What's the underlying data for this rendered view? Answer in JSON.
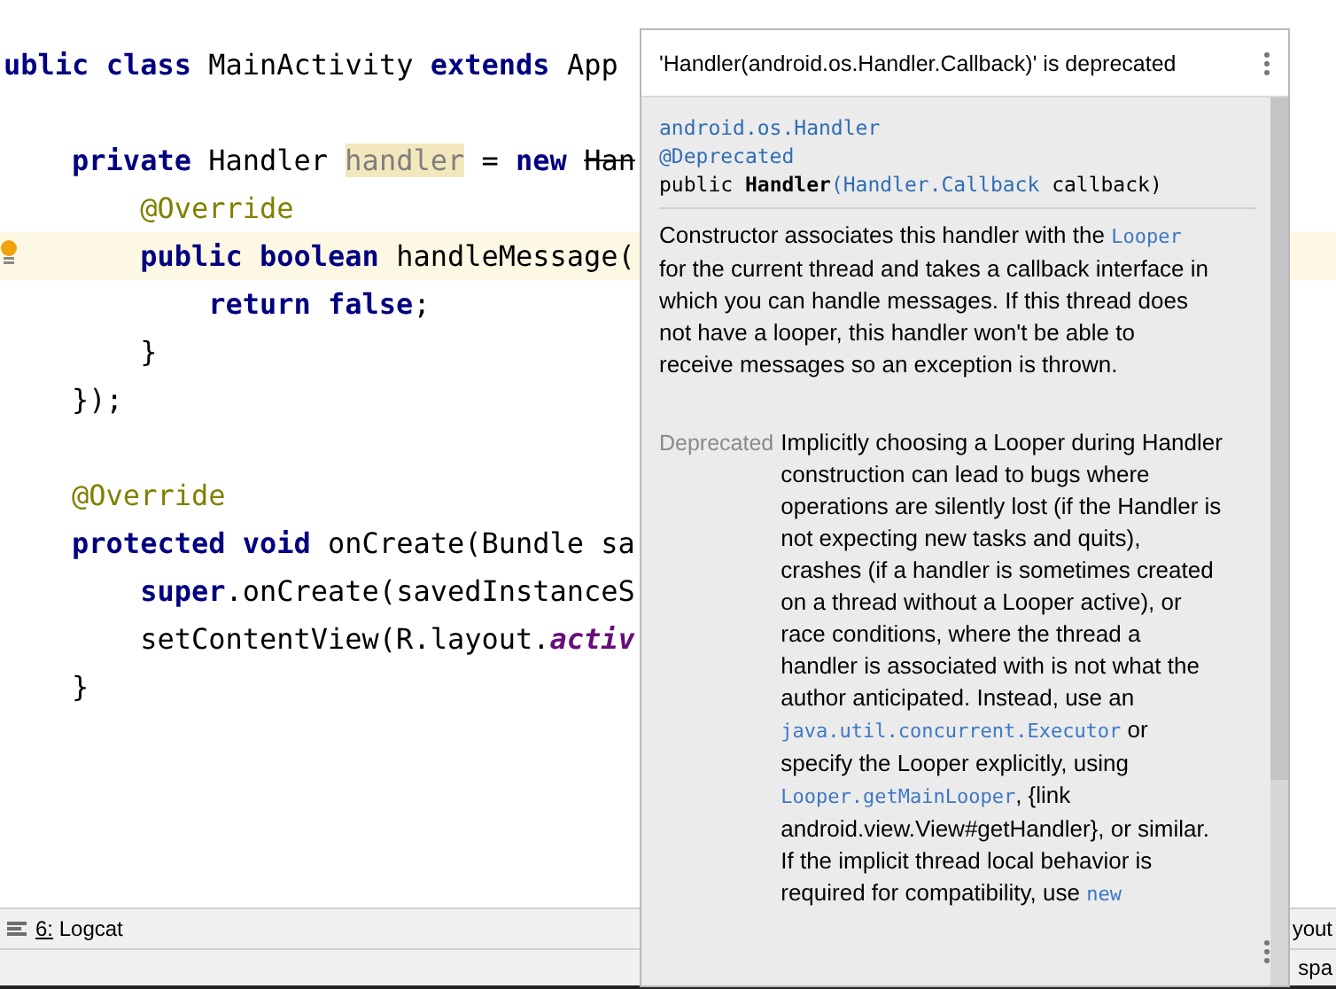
{
  "editor": {
    "lines": [
      {
        "kind": "code",
        "tokens": [
          {
            "kind": "keyword",
            "text": "ublic"
          },
          {
            "kind": "keyword",
            "text": " class"
          },
          {
            "kind": "plain",
            "text": " MainActivity "
          },
          {
            "kind": "keyword",
            "text": "extends"
          },
          {
            "kind": "plain",
            "text": " App"
          }
        ]
      },
      {
        "kind": "blank"
      },
      {
        "kind": "code",
        "tokens": [
          {
            "kind": "keyword",
            "text": "    private"
          },
          {
            "kind": "plain",
            "text": " Handler "
          },
          {
            "kind": "unused",
            "text": "handler"
          },
          {
            "kind": "plain",
            "text": " = "
          },
          {
            "kind": "keyword",
            "text": "new"
          },
          {
            "kind": "deprecated",
            "text": " Han"
          }
        ]
      },
      {
        "kind": "code",
        "tokens": [
          {
            "kind": "annotation",
            "text": "        @Override"
          }
        ]
      },
      {
        "kind": "code",
        "current": true,
        "bulb": true,
        "tokens": [
          {
            "kind": "keyword",
            "text": "        public boolean"
          },
          {
            "kind": "plain",
            "text": " handleMessage("
          }
        ]
      },
      {
        "kind": "code",
        "tokens": [
          {
            "kind": "keyword",
            "text": "            return false"
          },
          {
            "kind": "plain",
            "text": ";"
          }
        ]
      },
      {
        "kind": "code",
        "tokens": [
          {
            "kind": "plain",
            "text": "        }"
          }
        ]
      },
      {
        "kind": "code",
        "tokens": [
          {
            "kind": "plain",
            "text": "    });"
          }
        ]
      },
      {
        "kind": "blank"
      },
      {
        "kind": "code",
        "tokens": [
          {
            "kind": "annotation",
            "text": "    @Override"
          }
        ]
      },
      {
        "kind": "code",
        "tokens": [
          {
            "kind": "keyword",
            "text": "    protected void"
          },
          {
            "kind": "plain",
            "text": " onCreate(Bundle sa"
          }
        ]
      },
      {
        "kind": "code",
        "tokens": [
          {
            "kind": "keyword",
            "text": "        super"
          },
          {
            "kind": "plain",
            "text": ".onCreate(savedInstanceS"
          }
        ]
      },
      {
        "kind": "code",
        "tokens": [
          {
            "kind": "plain",
            "text": "        setContentView(R.layout."
          },
          {
            "kind": "static",
            "text": "activ"
          }
        ]
      },
      {
        "kind": "code",
        "tokens": [
          {
            "kind": "plain",
            "text": "    }"
          }
        ]
      }
    ]
  },
  "tool_window_bar": {
    "tab": "6: Logcat",
    "right_text": "yout"
  },
  "status_bar": {
    "right_text": "spa"
  },
  "popup": {
    "title": "'Handler(android.os.Handler.Callback)' is deprecated",
    "signature": [
      [
        {
          "kind": "link",
          "text": "android.os.Handler"
        }
      ],
      [
        {
          "kind": "link",
          "text": "@Deprecated"
        }
      ],
      [
        {
          "kind": "plain",
          "text": "public "
        },
        {
          "kind": "bold",
          "text": "Handler"
        },
        {
          "kind": "link",
          "text": "(Handler.Callback"
        },
        {
          "kind": "plain",
          "text": " callback)"
        }
      ]
    ],
    "description": [
      {
        "kind": "text",
        "text": "Constructor associates this handler with the "
      },
      {
        "kind": "code",
        "text": "Looper"
      },
      {
        "kind": "text",
        "text": " for the current thread and takes a callback interface in which you can handle messages. If this thread does not have a looper, this handler won't be able to receive messages so an exception is thrown."
      }
    ],
    "deprecated_label": "Deprecated",
    "deprecated_text": [
      {
        "kind": "text",
        "text": "Implicitly choosing a Looper during Handler construction can lead to bugs where operations are silently lost (if the Handler is not expecting new tasks and quits), crashes (if a handler is sometimes created on a thread without a Looper active), or race conditions, where the thread a handler is associated with is not what the author anticipated. Instead, use an "
      },
      {
        "kind": "code",
        "text": "java.util.concurrent.Executor"
      },
      {
        "kind": "text",
        "text": " or specify the Looper explicitly, using "
      },
      {
        "kind": "code",
        "text": "Looper.getMainLooper"
      },
      {
        "kind": "text",
        "text": ", {link android.view.View#getHandler}, or similar. If the implicit thread local behavior is required for compatibility, use "
      },
      {
        "kind": "code",
        "text": "new"
      }
    ]
  }
}
